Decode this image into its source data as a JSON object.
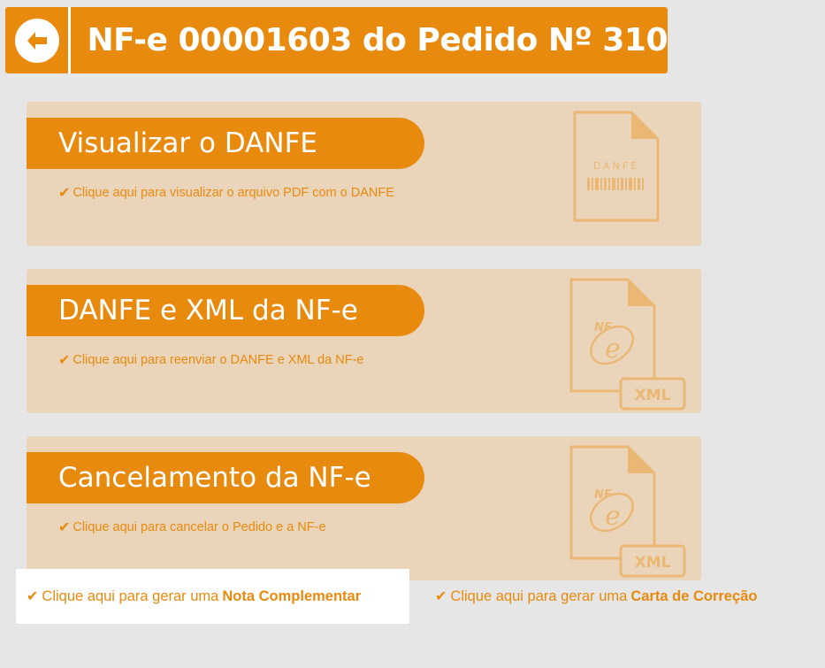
{
  "header": {
    "back_icon": "arrow-left-icon",
    "title": "NF-e 00001603 do Pedido Nº 310"
  },
  "cards": [
    {
      "title": "Visualizar o DANFE",
      "description": "Clique aqui para visualizar o arquivo PDF com o DANFE",
      "icon": "danfe-document-icon",
      "icon_label": "DANFE"
    },
    {
      "title": "DANFE e XML da NF-e",
      "description": "Clique aqui para reenviar o DANFE e XML da NF-e",
      "icon": "nfe-xml-document-icon",
      "icon_label": "XML",
      "icon_logo": "NF"
    },
    {
      "title": "Cancelamento da NF-e",
      "description": "Clique aqui para cancelar o Pedido e a NF-e",
      "icon": "nfe-xml-document-icon",
      "icon_label": "XML",
      "icon_logo": "NF"
    }
  ],
  "links": {
    "complementar_prefix": "Clique aqui para gerar uma",
    "complementar_bold": "Nota Complementar",
    "correcao_prefix": "Clique aqui para gerar uma",
    "correcao_bold": "Carta de Correção"
  },
  "colors": {
    "accent": "#e88a0e",
    "card_bg": "#ead5bb",
    "page_bg": "#e6e6e6"
  }
}
